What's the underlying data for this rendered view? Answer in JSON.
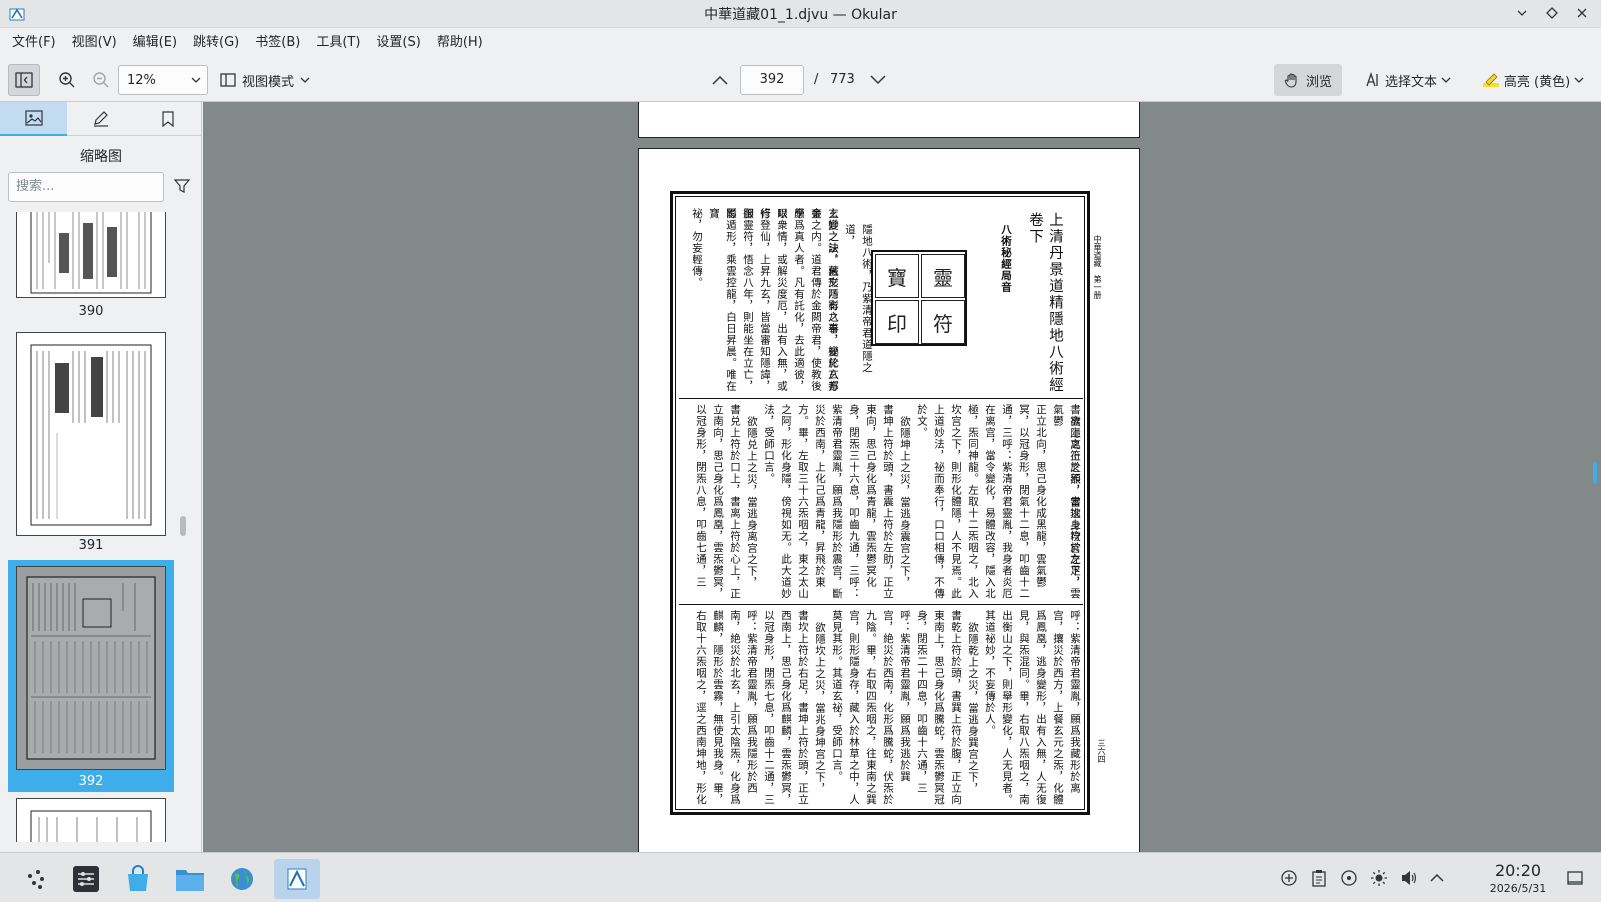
{
  "window": {
    "title": "中華道藏01_1.djvu — Okular"
  },
  "menubar": {
    "items": [
      "文件(F)",
      "视图(V)",
      "编辑(E)",
      "跳转(G)",
      "书签(B)",
      "工具(T)",
      "设置(S)",
      "帮助(H)"
    ]
  },
  "toolbar": {
    "zoom_value": "12%",
    "view_mode_label": "视图模式",
    "page_current": "392",
    "page_separator": "/",
    "page_total": "773",
    "browse_label": "浏览",
    "select_text_label": "选择文本",
    "highlight_label": "高亮 (黄色)"
  },
  "sidebar": {
    "heading": "缩略图",
    "search_placeholder": "搜索...",
    "thumbnails": [
      {
        "label": "390",
        "selected": false
      },
      {
        "label": "391",
        "selected": false
      },
      {
        "label": "392",
        "selected": true
      }
    ]
  },
  "document": {
    "page_header": "中華道藏　第一册",
    "title": "上清丹景道精隱地八術經",
    "juan": "卷下",
    "subtitle": "八術秘經局音",
    "page_number": "三六四",
    "top_columns": [
      "隱地八術，乃紫清帝君道隱之道，",
      "玄變之訣。舊文乃有八卷，變化八方",
      "上妙之法，藏形隱影之事，祕於玄都金",
      "臺之内。道君傳於金闕帝君，使教後學",
      "應爲真人者。凡有託化，去此適彼，以",
      "眼衆情，或解災度厄，出有入無，或修",
      "行登仙，上昇九玄，皆當審知隱諱，服",
      "御靈符，悟念八年，則能坐在立亡，隱",
      "影遁形，乘雲控龍，白日昇晨。唯在寶",
      "祕，勿妄輕傳。"
    ],
    "middle_columns": [
      "欲隱离上之炁，當逃身坎宫之下，",
      "書离上之符於額，書坎上符於左足，雲氣鬱",
      "正立北向，思己身化成黑龍，雲氣鬱",
      "冥，以冠身形，閉氣十二息，叩齒十二",
      "通，三呼：紫清帝君靈胤，我身者炎厄",
      "在离宫，當令變化，易體改容，隱入北",
      "極，炁同神龍。左取十二炁咽之，北入",
      "坎宫之下，則形化體隱，人不見焉。此",
      "上道妙法，祕而奉行，口口相傳，不傳",
      "於文。",
      "欲隱坤上之災，當逃身震宫之下，",
      "書坤上符於頭，書震上符於左肋，正立",
      "東向，思己身化爲青龍，雲炁鬱冥化",
      "身，閉炁三十六息，叩齒九通，三呼：",
      "紫清帝君靈胤，願爲我隱形於震宫，斷",
      "災於西南，上化己爲青龍，昇飛於東",
      "方。畢，左取三十六炁咽之，東之太山",
      "之阿，形化身隱，傍視如无。此大道妙",
      "法，受師口言。",
      "欲隱兑上之災，當逃身离宫之下，",
      "書兑上符於口上，書离上符於心上，正",
      "立南向，思己身化爲鳳凰，雲炁鬱冥，",
      "以冠身形，閉炁八息，叩齒七通，三"
    ],
    "bottom_columns": [
      "呼：紫清帝君靈胤，願爲我藏形於离",
      "宫，攘災於西方，上餐玄元之炁，化體",
      "爲鳳凰，逃身變形，出有入無，人无復",
      "見，與炁混同。畢，右取八炁咽之，南",
      "出衡山之下，則舉形變化，人无見者。",
      "其道祕妙，不妄傳於人。",
      "欲隱乾上之災，當逃身巽宫之下，",
      "書乾上符於頭，書巽上符於腹，正立向",
      "東南上，思己身化爲騰蛇，雲炁鬱冥冠",
      "身，閉炁二十四息，叩齒十六通，三",
      "呼：紫清帝君靈胤，願爲我逃於巽",
      "宫，絶災於西南，化形爲騰蛇，伏炁於",
      "九陰。畢，右取四炁咽之，往東南之巽",
      "宫，則形隱身存，藏入於林草之中，人",
      "莫見其形。其道玄祕，受師口言。",
      "欲隱坎上之災，當兆身坤宫之下，",
      "書坎上符於右足，書坤上符於頭，正立",
      "西南上，思己身化爲麒麟，雲炁鬱冥，",
      "以冠身形，閉炁七息，叩齒十二通，三",
      "呼：紫清帝君靈胤，願爲我隱形於西",
      "南，絶災於北玄，上引太陰炁，化身爲",
      "麒麟，隱形於雲霧，無使見我身。畢，",
      "右取十六炁咽之，逕之西南坤地，形化"
    ],
    "seal_chars": [
      "靈",
      "寶",
      "符",
      "印"
    ]
  },
  "taskbar": {
    "time": "20:20",
    "date": "2026/5/31"
  },
  "colors": {
    "accent": "#3daee9",
    "doc_background": "#838889",
    "panel": "#eff0f1"
  }
}
